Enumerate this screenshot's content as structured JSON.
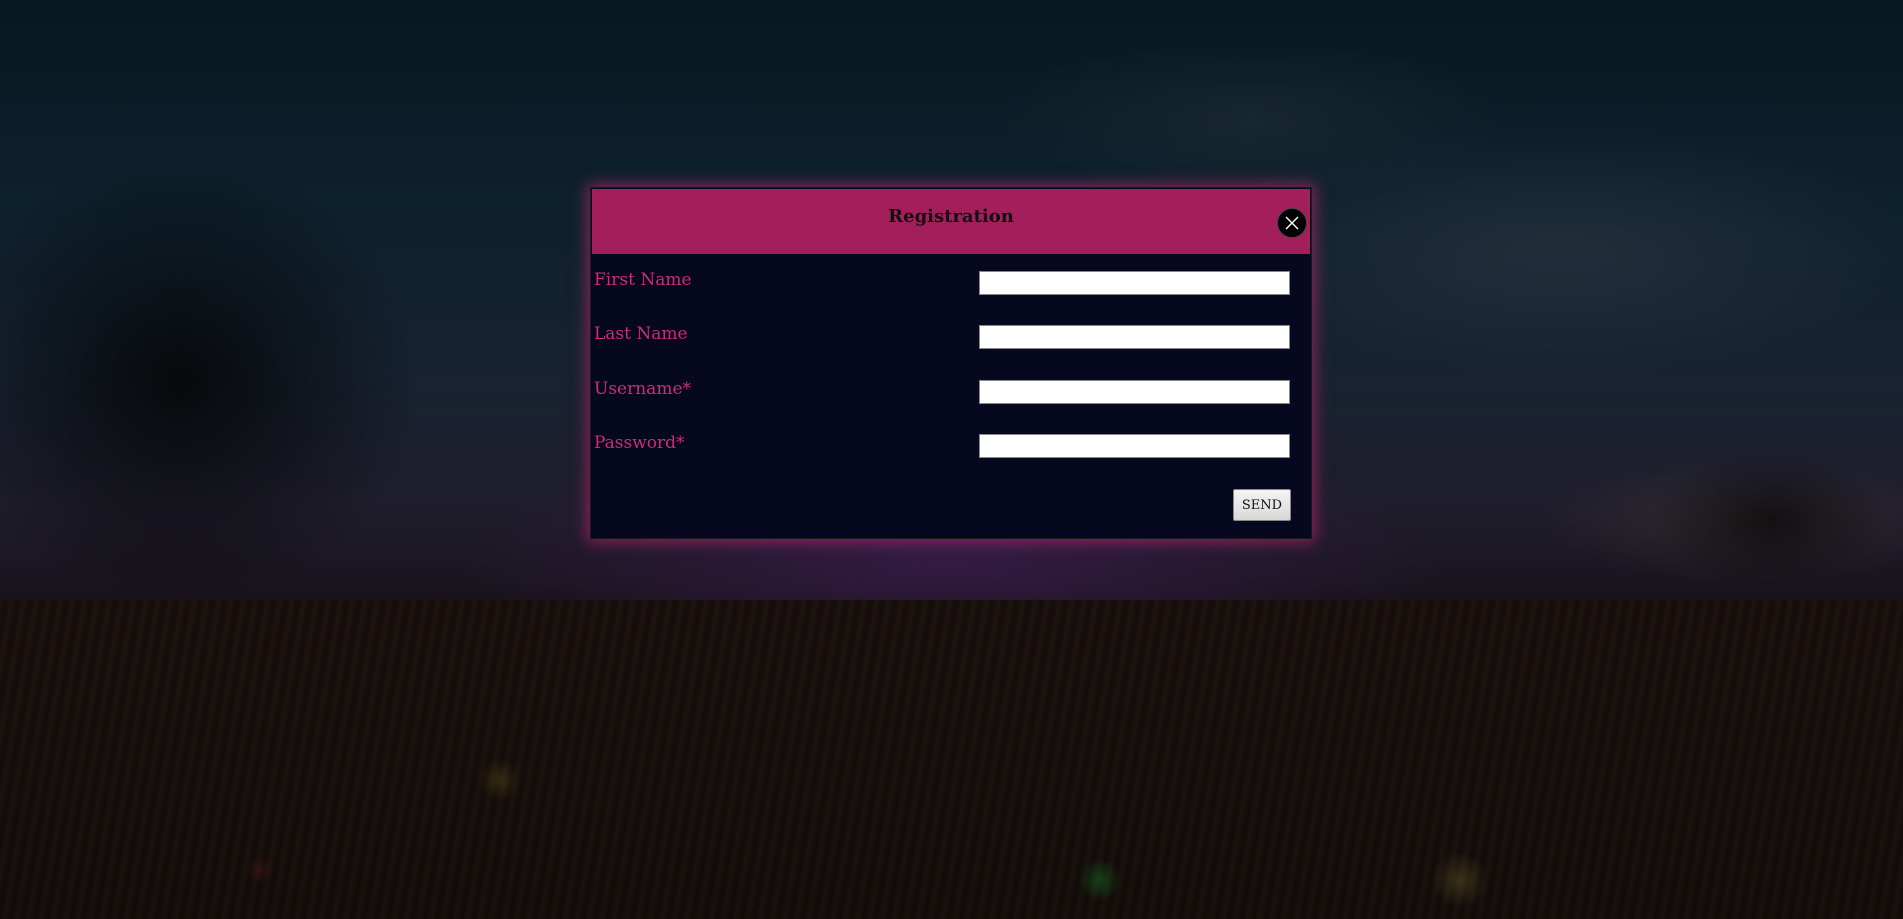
{
  "modal": {
    "title": "Registration",
    "close_icon": "close-icon",
    "fields": [
      {
        "label": "First Name",
        "value": ""
      },
      {
        "label": "Last Name",
        "value": ""
      },
      {
        "label": "Username*",
        "value": ""
      },
      {
        "label": "Password*",
        "value": ""
      }
    ],
    "send_label": "SEND"
  },
  "colors": {
    "header": "#a31f5b",
    "label": "#d02a7a",
    "body": "#060820",
    "glow": "#dc2882"
  }
}
